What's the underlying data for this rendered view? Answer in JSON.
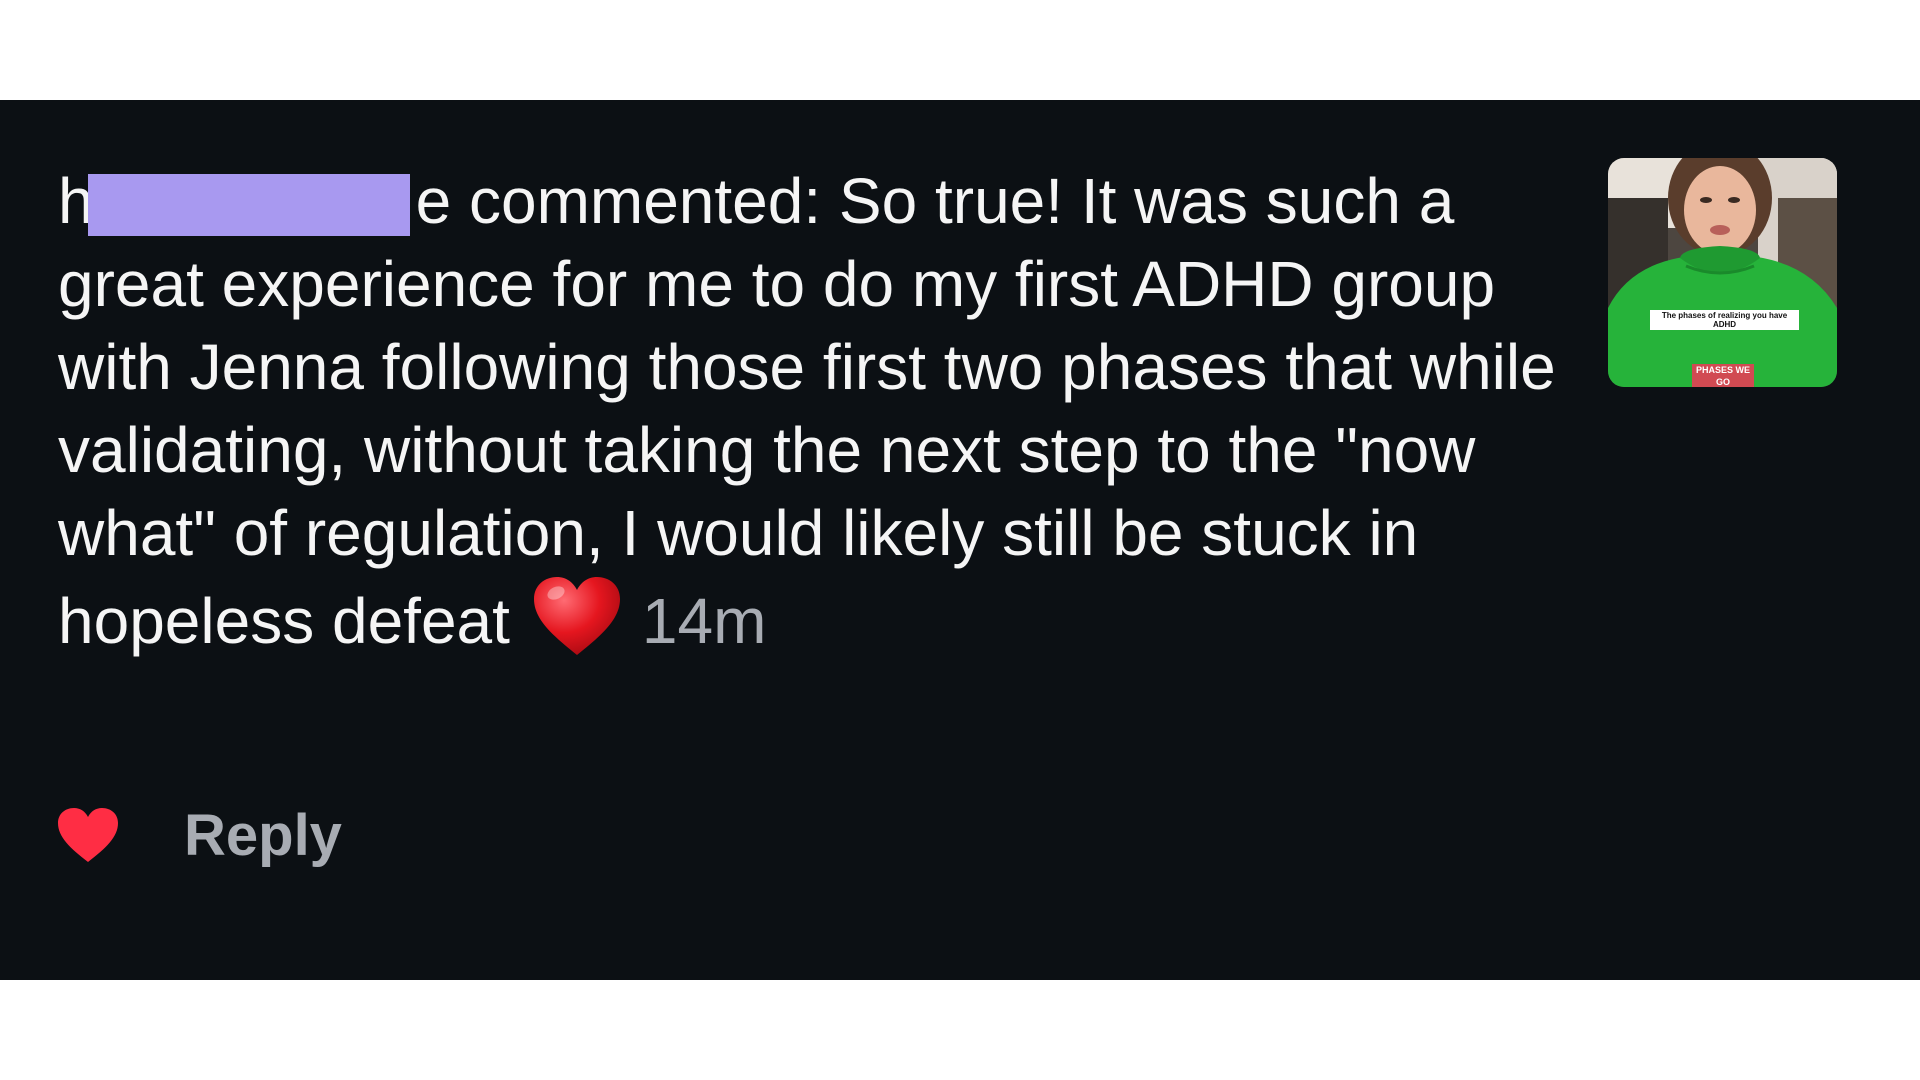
{
  "comment": {
    "username_visible_start": "h",
    "username_visible_end": "e",
    "body": "commented: So true! It was such a great experience for me to do my first ADHD group with Jenna following those first two phases that while validating, without taking the next step to the \"now what\" of regulation, I would likely still be stuck in hopeless defeat",
    "emoji_icon": "red-heart-emoji",
    "timestamp": "14m"
  },
  "thumbnail": {
    "caption": "The phases of realizing you have ADHD",
    "tag": "PHASES WE GO"
  },
  "actions": {
    "like_icon": "heart-icon",
    "like_color": "#ff2d44",
    "reply_label": "Reply"
  },
  "colors": {
    "background": "#0c1014",
    "text": "#f5f5f5",
    "muted": "#a8acb3",
    "redaction": "#a899f0"
  }
}
